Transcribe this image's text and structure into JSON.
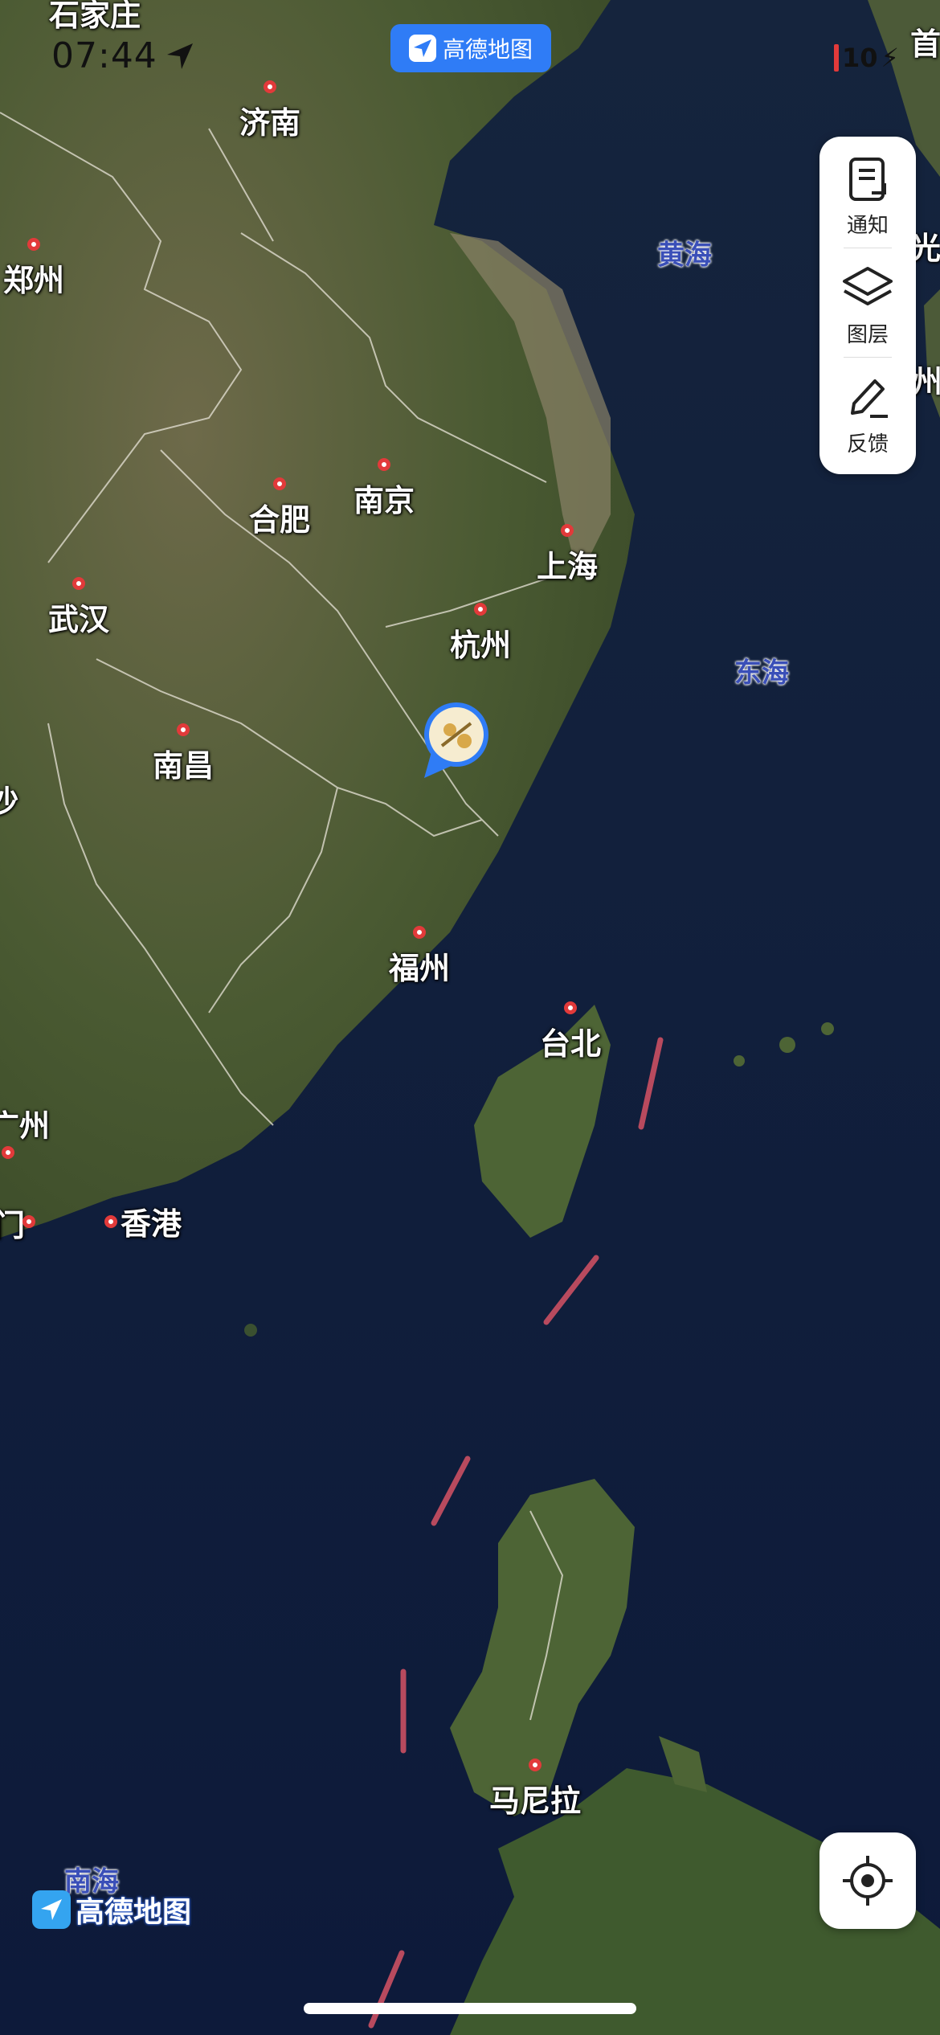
{
  "status_bar": {
    "time": "07:44",
    "battery": "10"
  },
  "app_badge": {
    "label": "高德地图"
  },
  "tools": [
    {
      "label": "通知",
      "icon": "notification-icon"
    },
    {
      "label": "图层",
      "icon": "layers-icon"
    },
    {
      "label": "反馈",
      "icon": "feedback-edit-icon"
    }
  ],
  "cities": [
    {
      "name": "济南"
    },
    {
      "name": "郑州"
    },
    {
      "name": "合肥"
    },
    {
      "name": "南京"
    },
    {
      "name": "上海"
    },
    {
      "name": "武汉"
    },
    {
      "name": "杭州"
    },
    {
      "name": "南昌"
    },
    {
      "name": "福州"
    },
    {
      "name": "台北"
    },
    {
      "name": "香港"
    },
    {
      "name": "马尼拉"
    }
  ],
  "partial_labels": {
    "top_left": "石家庄",
    "top_right": "首",
    "left_mid": "沙",
    "left_low": "广州",
    "left_macau": "门",
    "right_top": "光",
    "right_mid": "州"
  },
  "seas": [
    {
      "name": "黄海"
    },
    {
      "name": "东海"
    },
    {
      "name": "南海"
    }
  ],
  "logo": {
    "text": "高德地图"
  },
  "colors": {
    "accent": "#2f7cf6",
    "city_marker": "#e23a3a",
    "border_dash": "#b84a5e",
    "sea_label": "#3a4fb8"
  }
}
